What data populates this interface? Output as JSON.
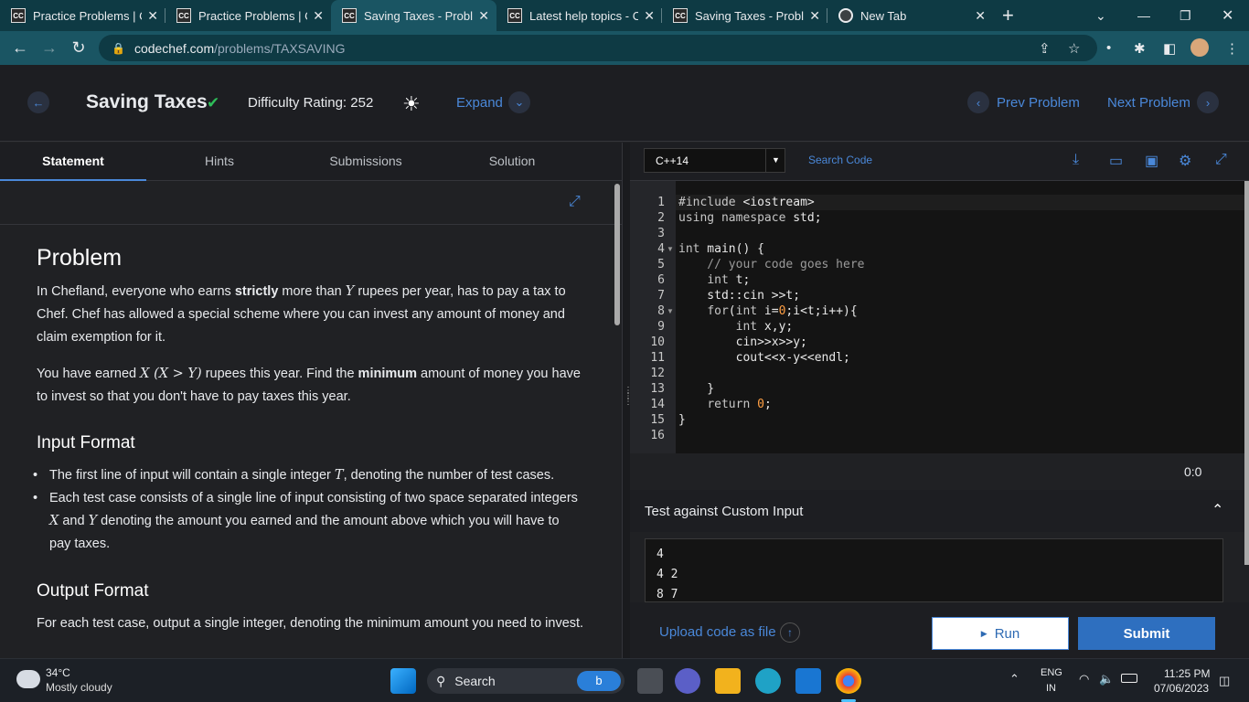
{
  "browser": {
    "tabs": [
      {
        "title": "Practice Problems | Co",
        "fav": "CC"
      },
      {
        "title": "Practice Problems | Co",
        "fav": "CC"
      },
      {
        "title": "Saving Taxes - Probler",
        "fav": "CC",
        "active": true
      },
      {
        "title": "Latest help topics - Co",
        "fav": "CC"
      },
      {
        "title": "Saving Taxes - Probler",
        "fav": "CC"
      },
      {
        "title": "New Tab",
        "fav": "chrome"
      }
    ],
    "url_host": "codechef.com",
    "url_path": "/problems/TAXSAVING"
  },
  "header": {
    "title": "Saving Taxes",
    "difficulty": "Difficulty Rating: 252",
    "expand": "Expand",
    "prev": "Prev Problem",
    "next": "Next Problem"
  },
  "tabs": [
    "Statement",
    "Hints",
    "Submissions",
    "Solution"
  ],
  "statement": {
    "heading": "Problem",
    "p1_a": "In Chefland, everyone who earns ",
    "p1_b": "strictly",
    "p1_c": " more than ",
    "p1_var": "Y",
    "p1_d": " rupees per year, has to pay a tax to Chef. Chef has allowed a special scheme where you can invest any amount of money and claim exemption for it.",
    "p2_a": "You have earned ",
    "p2_math": "X (X > Y)",
    "p2_b": " rupees this year. Find the ",
    "p2_c": "minimum",
    "p2_d": " amount of money you have to invest so that you don't have to pay taxes this year.",
    "input_heading": "Input Format",
    "b1_a": "The first line of input will contain a single integer ",
    "b1_var": "T",
    "b1_b": ", denoting the number of test cases.",
    "b2_a": "Each test case consists of a single line of input consisting of two space separated integers ",
    "b2_x": "X",
    "b2_b": " and ",
    "b2_y": "Y",
    "b2_c": " denoting the amount you earned and the amount above which you will have to pay taxes.",
    "output_heading": "Output Format",
    "out_text": "For each test case, output a single integer, denoting the minimum amount you need to invest."
  },
  "editor": {
    "language": "C++14",
    "search": "Search Code",
    "cursor": "0:0",
    "line_numbers": [
      "1",
      "2",
      "3",
      "4",
      "5",
      "6",
      "7",
      "8",
      "9",
      "10",
      "11",
      "12",
      "13",
      "14",
      "15",
      "16"
    ]
  },
  "custom": {
    "title": "Test against Custom Input",
    "lines": [
      "4",
      "4 2",
      "8 7"
    ]
  },
  "actions": {
    "upload": "Upload code as file",
    "run": "Run",
    "submit": "Submit"
  },
  "taskbar": {
    "temp": "34°C",
    "weather": "Mostly cloudy",
    "search": "Search",
    "lang1": "ENG",
    "lang2": "IN",
    "time": "11:25 PM",
    "date": "07/06/2023"
  }
}
